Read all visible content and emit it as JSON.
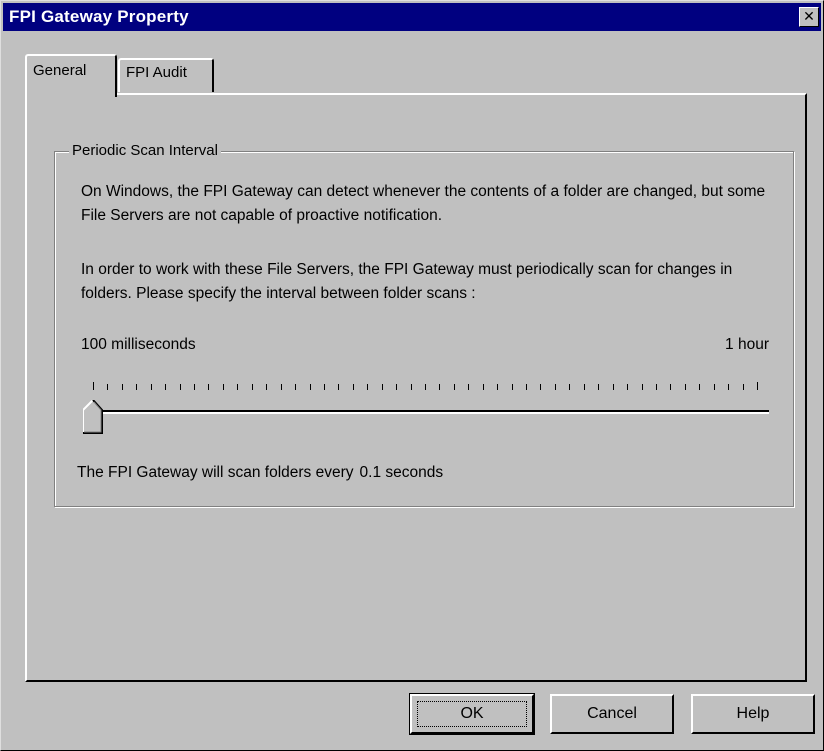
{
  "window": {
    "title": "FPI Gateway Property",
    "close_glyph": "✕"
  },
  "tabs": [
    {
      "label": "General",
      "active": true
    },
    {
      "label": "FPI Audit",
      "active": false
    }
  ],
  "group": {
    "title": "Periodic Scan Interval",
    "paragraph1": "On Windows, the FPI Gateway can detect whenever the contents of a folder are changed, but some File Servers are not capable of proactive notification.",
    "paragraph2": "In order to work with these File Servers, the FPI Gateway must periodically scan for changes in folders. Please specify the interval between folder scans :",
    "slider": {
      "min_label": "100 milliseconds",
      "max_label": "1 hour",
      "position": 0,
      "tick_count": 47
    },
    "status_prefix": "The FPI Gateway will scan folders every",
    "status_value": "0.1 seconds"
  },
  "buttons": {
    "ok": "OK",
    "cancel": "Cancel",
    "help": "Help"
  },
  "colors": {
    "titlebar": "#000080",
    "face": "#c0c0c0"
  },
  "icons": {
    "close": "close-icon",
    "slider_thumb": "slider-thumb-icon"
  }
}
